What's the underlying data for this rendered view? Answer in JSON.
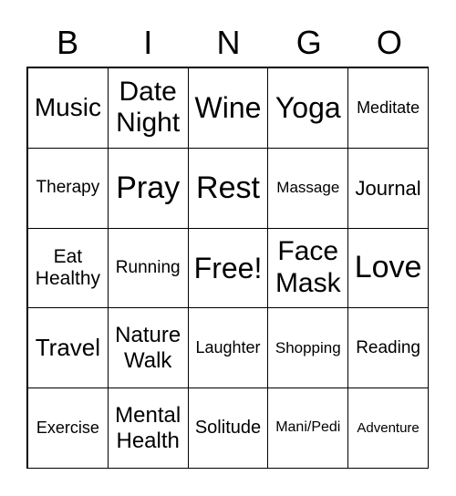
{
  "header": [
    "B",
    "I",
    "N",
    "G",
    "O"
  ],
  "cells": [
    [
      "Music"
    ],
    [
      "Date",
      "Night"
    ],
    [
      "Wine"
    ],
    [
      "Yoga"
    ],
    [
      "Meditate"
    ],
    [
      "Therapy"
    ],
    [
      "Pray"
    ],
    [
      "Rest"
    ],
    [
      "Massage"
    ],
    [
      "Journal"
    ],
    [
      "Eat",
      "Healthy"
    ],
    [
      "Running"
    ],
    [
      "Free!"
    ],
    [
      "Face",
      "Mask"
    ],
    [
      "Love"
    ],
    [
      "Travel"
    ],
    [
      "Nature",
      "Walk"
    ],
    [
      "Laughter"
    ],
    [
      "Shopping"
    ],
    [
      "Reading"
    ],
    [
      "Exercise"
    ],
    [
      "Mental",
      "Health"
    ],
    [
      "Solitude"
    ],
    [
      "Mani/Pedi"
    ],
    [
      "Adventure"
    ]
  ]
}
